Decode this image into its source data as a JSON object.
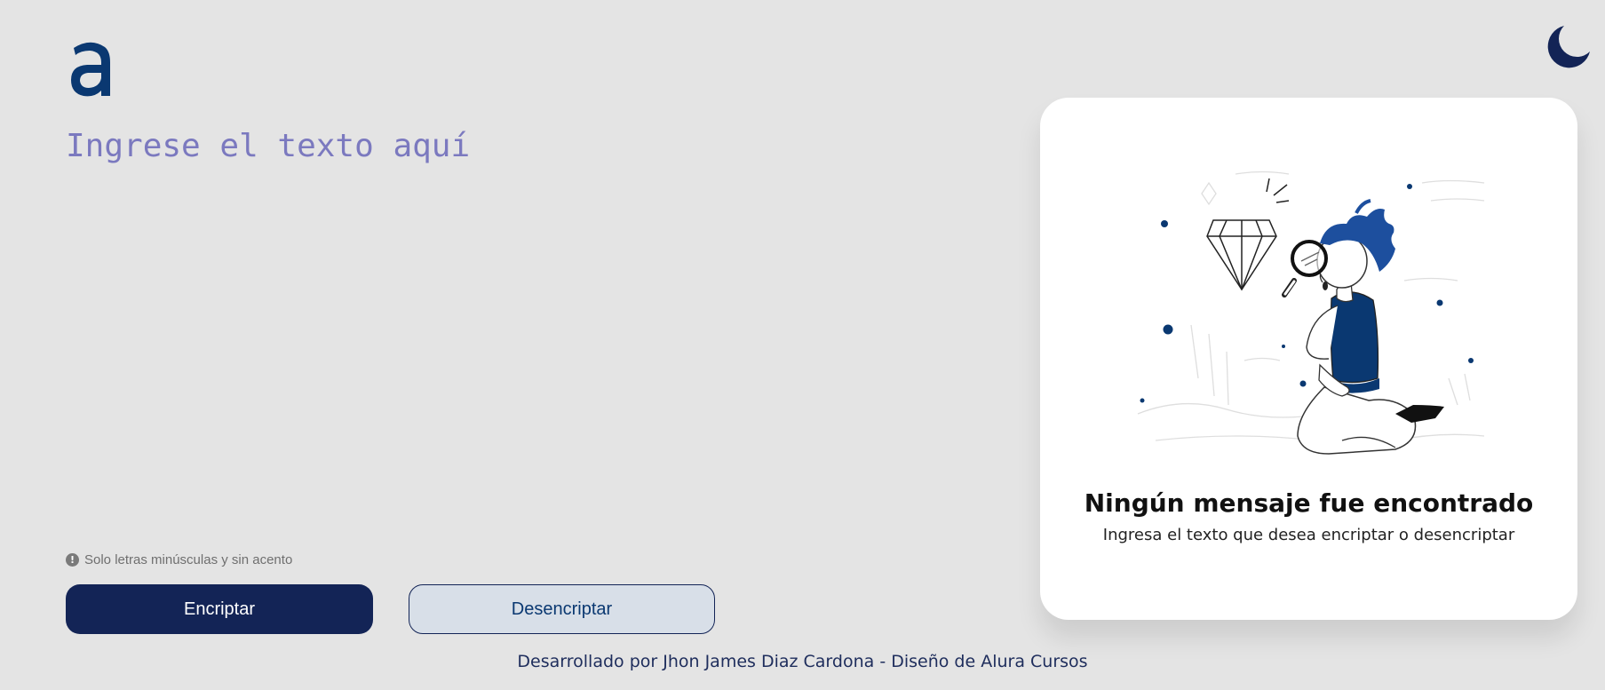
{
  "input": {
    "placeholder": "Ingrese el texto aquí"
  },
  "hint": {
    "icon": "info-icon",
    "icon_glyph": "!",
    "text": "Solo letras minúsculas y sin acento"
  },
  "buttons": {
    "encrypt_label": "Encriptar",
    "decrypt_label": "Desencriptar"
  },
  "result_panel": {
    "title": "Ningún mensaje fue encontrado",
    "subtitle": "Ingresa el texto que desea encriptar o desencriptar",
    "illustration": "person-magnifying-glass-diamond"
  },
  "header": {
    "logo": "alura-logo",
    "theme_toggle": "moon-icon"
  },
  "footer": {
    "text": "Desarrollado por Jhon James Diaz Cardona - Diseño de Alura Cursos"
  },
  "colors": {
    "background": "#e4e4e4",
    "brand_dark": "#132456",
    "brand_blue": "#0a3871",
    "placeholder": "#7b79bf",
    "secondary_button": "#d8dfe8",
    "card": "#ffffff"
  }
}
